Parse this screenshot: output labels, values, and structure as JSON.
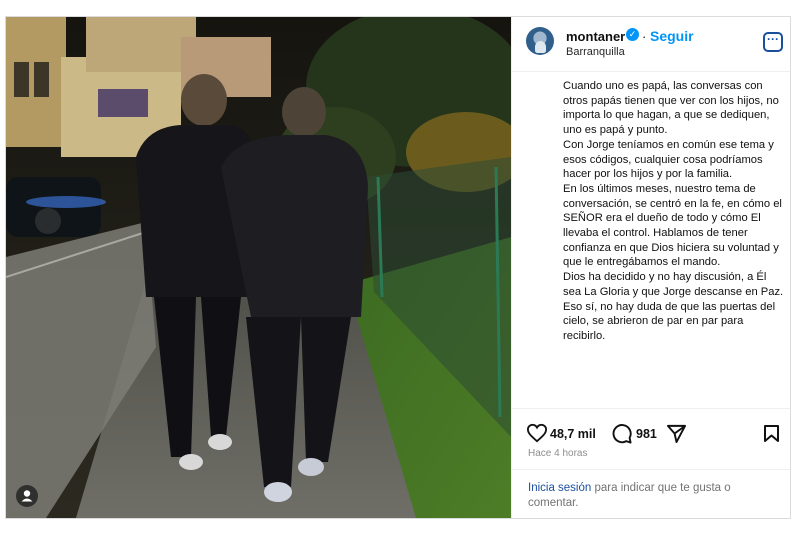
{
  "post": {
    "username": "montaner",
    "follow_label": "Seguir",
    "separator": "·",
    "location": "Barranquilla",
    "caption": [
      "Cuando uno es papá, las conversas con otros papás tienen que ver con los hijos, no importa lo que hagan, a que se dediquen, uno es papá y punto.",
      "Con Jorge teníamos en común ese tema y esos códigos, cualquier cosa podríamos hacer por los hijos y por la familia.",
      "En los últimos meses, nuestro tema de conversación, se centró en la fe, en cómo el SEÑOR era el dueño de todo y cómo El llevaba el control. Hablamos de tener confianza en que Dios hiciera su voluntad y que le entregábamos el mando.",
      "Dios ha decidido y no hay discusión, a Él sea La Gloria y que Jorge descanse en Paz.",
      "Eso sí, no hay duda de que las puertas del cielo, se abrieron de par en par para recibirlo."
    ],
    "likes": "48,7 mil",
    "comments": "981",
    "time_ago": "Hace 4 horas",
    "login_link": "Inicia sesión",
    "login_text": " para indicar que te gusta o comentar."
  },
  "icons": {
    "verified": "verified-badge-icon",
    "more": "more-options-icon",
    "like": "heart-icon",
    "comment": "comment-bubble-icon",
    "share": "send-icon",
    "save": "bookmark-icon",
    "tag": "user-tag-icon"
  },
  "colors": {
    "accent": "#0095f6",
    "link": "#1a4f9c",
    "muted": "#8e8e8e"
  }
}
